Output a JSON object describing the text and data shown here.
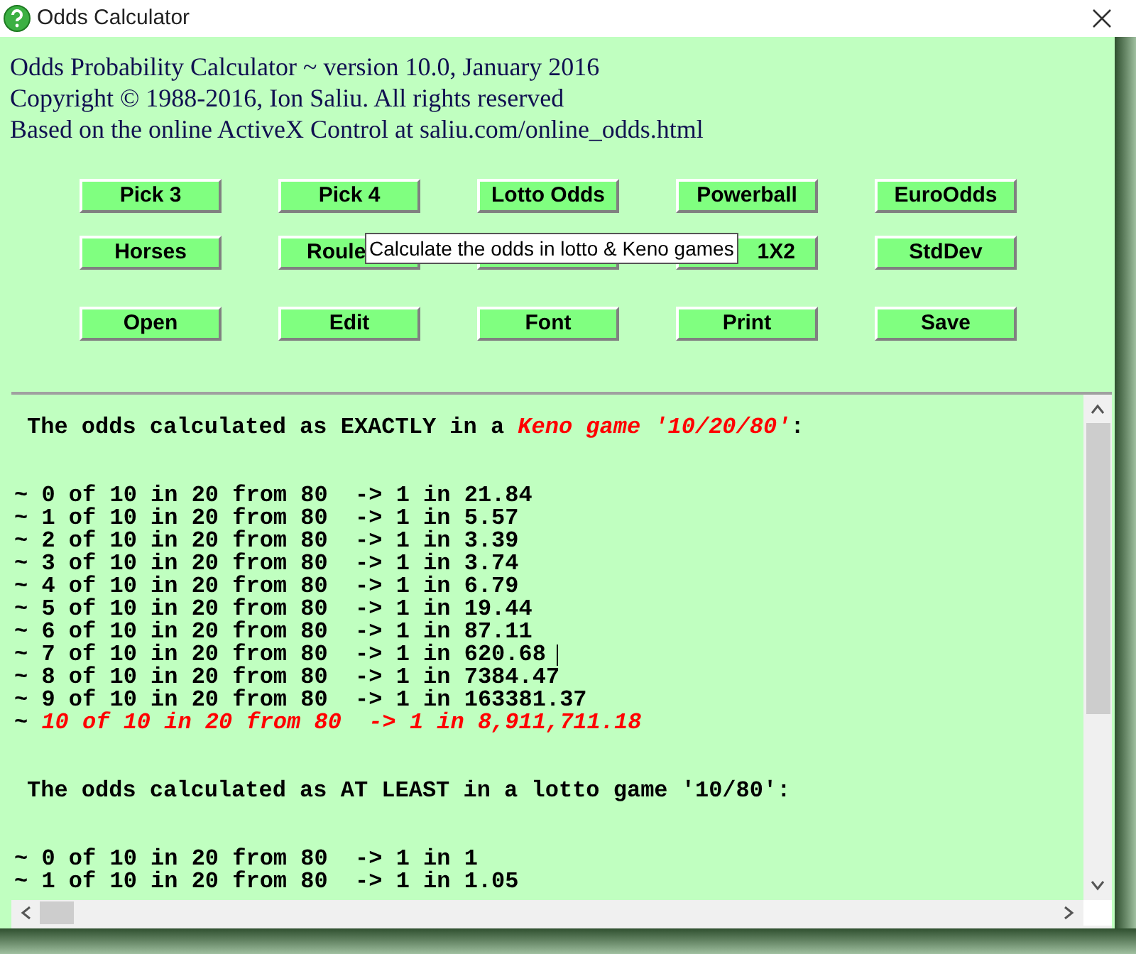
{
  "window": {
    "title": "Odds Calculator"
  },
  "header": [
    "Odds Probability Calculator ~ version 10.0, January 2016",
    "Copyright © 1988-2016, Ion Saliu. All rights reserved",
    "Based on the online ActiveX Control at saliu.com/online_odds.html"
  ],
  "button_rows": [
    [
      {
        "label": "Pick 3",
        "kind": "full"
      },
      {
        "label": "Pick 4",
        "kind": "full"
      },
      {
        "label": "Lotto Odds",
        "kind": "full"
      },
      {
        "label": "Powerball",
        "kind": "full"
      },
      {
        "label": "EuroOdds",
        "kind": "full"
      }
    ],
    [
      {
        "label": "Horses",
        "kind": "full"
      },
      {
        "label": "Roule",
        "kind": "cut_end"
      },
      {
        "kind": "hidden"
      },
      {
        "label": "1X2",
        "kind": "cut_start"
      },
      {
        "label": "StdDev",
        "kind": "full"
      }
    ],
    [
      {
        "label": "Open",
        "kind": "full"
      },
      {
        "label": "Edit",
        "kind": "full"
      },
      {
        "label": "Font",
        "kind": "full"
      },
      {
        "label": "Print",
        "kind": "full"
      },
      {
        "label": "Save",
        "kind": "full"
      }
    ]
  ],
  "tooltip": "Calculate the odds in lotto & Keno games",
  "output": [
    {
      "heading": "The odds calculated as EXACTLY in a *Keno game '10/20/80'*:",
      "rows": [
        {
          "text": "~ 0 of 10 in 20 from 80  -> 1 in 21.84",
          "cursor": false
        },
        {
          "text": "~ 1 of 10 in 20 from 80  -> 1 in 5.57",
          "cursor": false
        },
        {
          "text": "~ 2 of 10 in 20 from 80  -> 1 in 3.39",
          "cursor": false
        },
        {
          "text": "~ 3 of 10 in 20 from 80  -> 1 in 3.74",
          "cursor": false
        },
        {
          "text": "~ 4 of 10 in 20 from 80  -> 1 in 6.79",
          "cursor": false
        },
        {
          "text": "~ 5 of 10 in 20 from 80  -> 1 in 19.44",
          "cursor": false
        },
        {
          "text": "~ 6 of 10 in 20 from 80  -> 1 in 87.11",
          "cursor": false
        },
        {
          "text": "~ 7 of 10 in 20 from 80  -> 1 in 620.68",
          "cursor": true
        },
        {
          "text": "~ 8 of 10 in 20 from 80  -> 1 in 7384.47",
          "cursor": false
        },
        {
          "text": "~ 9 of 10 in 20 from 80  -> 1 in 163381.37",
          "cursor": false
        },
        {
          "text": "~ *10 of 10 in 20 from 80  -> 1 in 8,911,711.18*",
          "cursor": false
        }
      ]
    },
    {
      "heading": "The odds calculated as AT LEAST in a lotto game '10/80':",
      "rows": [
        {
          "text": "~ 0 of 10 in 20 from 80  -> 1 in 1",
          "cursor": false
        },
        {
          "text": "~ 1 of 10 in 20 from 80  -> 1 in 1.05",
          "cursor": false
        }
      ]
    }
  ]
}
